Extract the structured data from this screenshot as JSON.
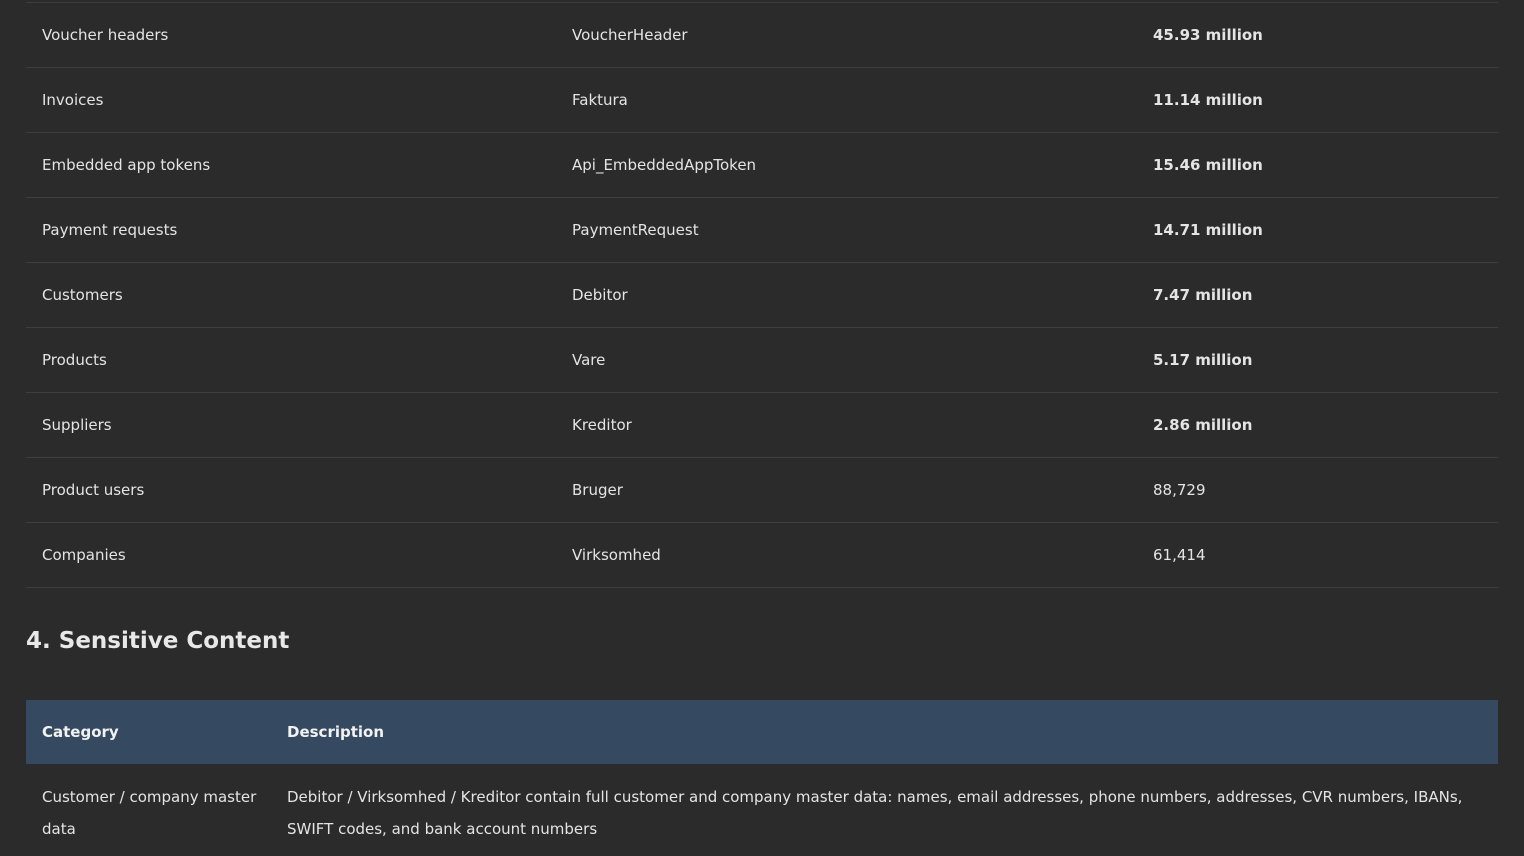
{
  "record_table": {
    "rows": [
      {
        "name": "Voucher headers",
        "table": "VoucherHeader",
        "count": "45.93 million",
        "bold": true
      },
      {
        "name": "Invoices",
        "table": "Faktura",
        "count": "11.14 million",
        "bold": true
      },
      {
        "name": "Embedded app tokens",
        "table": "Api_EmbeddedAppToken",
        "count": "15.46 million",
        "bold": true
      },
      {
        "name": "Payment requests",
        "table": "PaymentRequest",
        "count": "14.71 million",
        "bold": true
      },
      {
        "name": "Customers",
        "table": "Debitor",
        "count": "7.47 million",
        "bold": true
      },
      {
        "name": "Products",
        "table": "Vare",
        "count": "5.17 million",
        "bold": true
      },
      {
        "name": "Suppliers",
        "table": "Kreditor",
        "count": "2.86 million",
        "bold": true
      },
      {
        "name": "Product users",
        "table": "Bruger",
        "count": "88,729",
        "bold": false
      },
      {
        "name": "Companies",
        "table": "Virksomhed",
        "count": "61,414",
        "bold": false
      }
    ]
  },
  "section": {
    "heading": "4. Sensitive Content"
  },
  "sensitive_table": {
    "headers": {
      "category": "Category",
      "description": "Description"
    },
    "rows": [
      {
        "category": "Customer / company master data",
        "description": "Debitor / Virksomhed / Kreditor contain full customer and company master data: names, email addresses, phone numbers, addresses, CVR numbers, IBANs, SWIFT codes, and bank account numbers"
      }
    ]
  },
  "colors": {
    "background": "#2b2b2b",
    "header_row": "#354a61",
    "row_divider": "#3e3e3e"
  }
}
